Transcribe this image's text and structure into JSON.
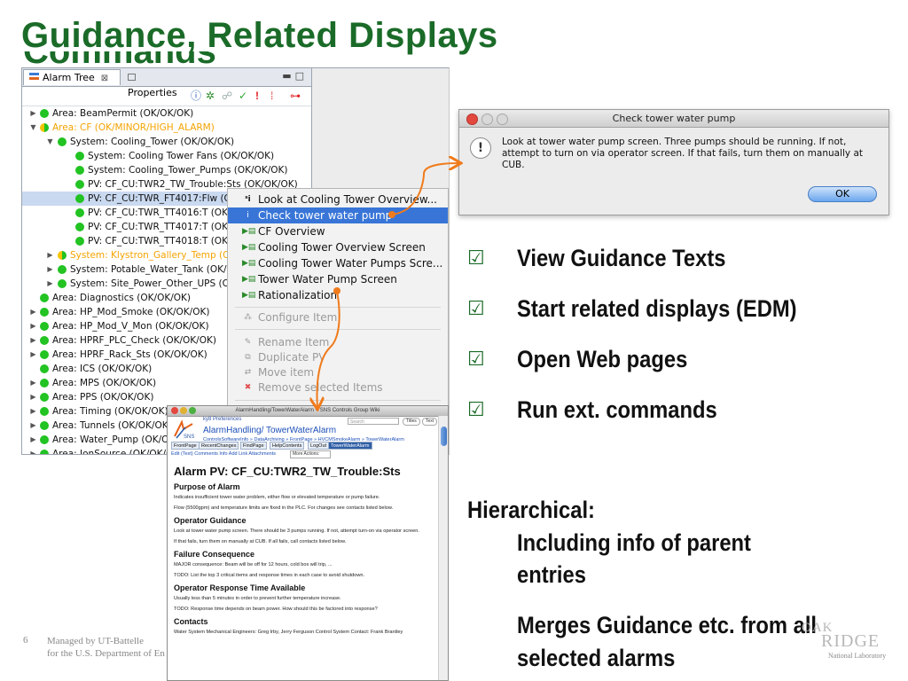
{
  "slide": {
    "title": "Guidance, Related Displays",
    "title_clipped": "Commands"
  },
  "alarm_tree": {
    "tab_alarm_tree": "Alarm Tree",
    "tab_properties": "Properties",
    "rows": [
      {
        "label": "Area: BeamPermit (OK/OK/OK)"
      },
      {
        "label": "Area: CF (OK/MINOR/HIGH_ALARM)"
      },
      {
        "label": "System: Cooling_Tower (OK/OK/OK)"
      },
      {
        "label": "System: Cooling Tower Fans (OK/OK/OK)"
      },
      {
        "label": "System: Cooling_Tower_Pumps (OK/OK/OK)"
      },
      {
        "label": "PV: CF_CU:TWR2_TW_Trouble:Sts (OK/OK/OK)"
      },
      {
        "label": "PV: CF_CU:TWR_FT4017:Flw (OK"
      },
      {
        "label": "PV: CF_CU:TWR_TT4016:T (OK/"
      },
      {
        "label": "PV: CF_CU:TWR_TT4017:T (OK/"
      },
      {
        "label": "PV: CF_CU:TWR_TT4018:T (OK/"
      },
      {
        "label": "System: Klystron_Gallery_Temp (OK/"
      },
      {
        "label": "System: Potable_Water_Tank (OK/OK"
      },
      {
        "label": "System: Site_Power_Other_UPS (OK/"
      },
      {
        "label": "Area: Diagnostics (OK/OK/OK)"
      },
      {
        "label": "Area: HP_Mod_Smoke (OK/OK/OK)"
      },
      {
        "label": "Area: HP_Mod_V_Mon (OK/OK/OK)"
      },
      {
        "label": "Area: HPRF_PLC_Check (OK/OK/OK)"
      },
      {
        "label": "Area: HPRF_Rack_Sts (OK/OK/OK)"
      },
      {
        "label": "Area: ICS (OK/OK/OK)"
      },
      {
        "label": "Area: MPS (OK/OK/OK)"
      },
      {
        "label": "Area: PPS (OK/OK/OK)"
      },
      {
        "label": "Area: Timing (OK/OK/OK)"
      },
      {
        "label": "Area: Tunnels (OK/OK/OK)"
      },
      {
        "label": "Area: Water_Pump (OK/OK"
      },
      {
        "label": "Area: IonSource (OK/OK/OI"
      }
    ]
  },
  "context_menu": {
    "items": [
      {
        "label": "Look at Cooling Tower Overview..."
      },
      {
        "label": "Check tower water pump"
      },
      {
        "label": "CF Overview"
      },
      {
        "label": "Cooling Tower Overview Screen"
      },
      {
        "label": "Cooling Tower Water Pumps Scre..."
      },
      {
        "label": "Tower Water Pump Screen"
      },
      {
        "label": "Rationalization"
      },
      {
        "label": "Configure Item"
      },
      {
        "label": "Rename Item"
      },
      {
        "label": "Duplicate PV"
      },
      {
        "label": "Move item"
      },
      {
        "label": "Remove selected Items"
      }
    ]
  },
  "dialog": {
    "title": "Check tower water pump",
    "message": "Look at tower water pump screen. Three pumps should be running.  If not, attempt to turn on via operator screen.  If that fails, turn them on manually at CUB.",
    "ok_label": "OK"
  },
  "wiki": {
    "window_title": "AlarmHandling/TowerWaterAlarm < SNS Controls Group Wiki",
    "preferences": "ky8 Preferences",
    "search_placeholder": "Search",
    "title_btn": "Titles",
    "text_btn": "Text",
    "page_title": "AlarmHandling/ TowerWaterAlarm",
    "breadcrumb": "ControlsSoftwareInfo » DataArchiving » FrontPage » HVCMSmokeAlarm » TowerWaterAlarm",
    "tabs": [
      "FrontPage",
      "RecentChanges",
      "FindPage",
      "HelpContents",
      "LogOut",
      "TowerWaterAlarm"
    ],
    "actions": "Edit (Text)  Comments  Info  Add Link  Attachments",
    "more_actions": "More Actions:",
    "h1": "Alarm PV: CF_CU:TWR2_TW_Trouble:Sts",
    "purpose_h": "Purpose of Alarm",
    "purpose_p1": "Indicates insufficient tower water problem, either flow or elevated temperature or pump failure.",
    "purpose_p2": "Flow (5500gpm) and temperature limits are fixed in the PLC. For changes see contacts listed below.",
    "guidance_h": "Operator Guidance",
    "guidance_p1": "Look at tower water pump screen. There should be 3 pumps running. If not, attempt turn-on via operator screen.",
    "guidance_p2": "If that fails, turn them on manually at CUB. If all fails, call contacts listed below.",
    "failure_h": "Failure Consequence",
    "failure_p1": "MAJOR consequence: Beam will be off for 12 hours, cold box will trip, ...",
    "failure_p2": "TODO: List the top 3 critical items and response times in each case to avoid shutdown.",
    "response_h": "Operator Response Time Available",
    "response_p1": "Usually less than 5 minutes in order to prevent further temperature increase.",
    "response_p2": "TODO: Response time depends on beam power. How should this be factored into response?",
    "contacts_h": "Contacts",
    "contacts_p": "Water System Mechanical Engineers: Greg Irby, Jerry Ferguson Control System Contact: Frank Brantley"
  },
  "bullets": [
    "View Guidance Texts",
    "Start related displays (EDM)",
    "Open Web pages",
    "Run ext. commands"
  ],
  "hierarchical": {
    "heading": "Hierarchical:",
    "line1": "Including info of parent",
    "line2": "entries",
    "line3": "Merges Guidance etc. from all",
    "line4": "selected alarms"
  },
  "footer": {
    "page_number": "6",
    "line1": "Managed by UT-Battelle",
    "line2": "for the U.S. Department of Energy"
  },
  "logo": {
    "oak": "OAK",
    "ridge": "RIDGE",
    "national_lab": "National Laboratory"
  },
  "colors": {
    "title_green": "#1a6b28",
    "ok_green": "#22c322",
    "alarm_orange": "#f4a300",
    "menu_highlight": "#3875d7",
    "arrow_orange": "#f07b1c"
  },
  "icons": {
    "checkbox": "checked-box-icon",
    "status": "status-dot-icon",
    "dialog": "exclamation-icon"
  }
}
